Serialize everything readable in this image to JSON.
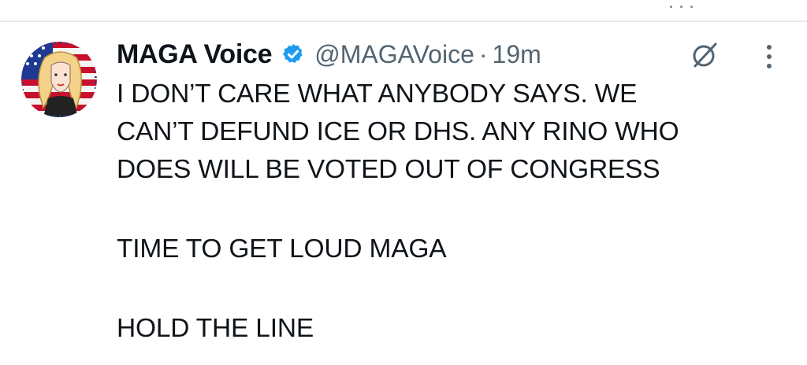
{
  "tweet": {
    "author": {
      "display_name": "MAGA Voice",
      "handle": "@MAGAVoice",
      "verified": true,
      "verified_color": "#1d9bf0",
      "avatar_icon": "avatar-illustration-flag"
    },
    "separator": "·",
    "time": "19m",
    "paragraphs": [
      {
        "lines": [
          "I DON’T CARE WHAT ANYBODY SAYS. WE",
          "CAN’T DEFUND ICE OR DHS. ANY RINO WHO",
          "DOES WILL BE VOTED OUT OF CONGRESS"
        ]
      },
      {
        "lines": [
          "TIME TO GET LOUD MAGA"
        ]
      },
      {
        "lines": [
          "HOLD THE LINE"
        ]
      }
    ],
    "icons": {
      "grok": "grok-icon",
      "more": "more-vertical-icon",
      "verified": "verified-badge-icon"
    }
  },
  "colors": {
    "text": "#0f1419",
    "secondary": "#536471",
    "divider": "#e6e9ec"
  }
}
